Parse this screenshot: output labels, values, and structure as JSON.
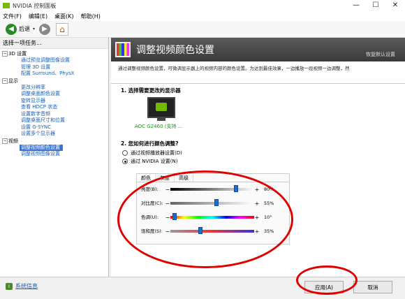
{
  "window": {
    "title": "NVIDIA 控制面板",
    "controls": [
      "—",
      "☐",
      "✕"
    ]
  },
  "menu": [
    "文件(F)",
    "编辑(E)",
    "桌面(K)",
    "帮助(H)"
  ],
  "toolbar": {
    "back_label": "后退",
    "forward_dropdown": "▾"
  },
  "left": {
    "header": "选择一项任务...",
    "tree": [
      {
        "category": "3D 设置",
        "items": [
          "通过预览调整图像设置",
          "管理 3D 设置",
          "配置 Surround、PhysX"
        ]
      },
      {
        "category": "显示",
        "items": [
          "更改分辨率",
          "调整桌面颜色设置",
          "旋转显示器",
          "查看 HDCP 状态",
          "设置数字音频",
          "调整桌面尺寸和位置",
          "设置 G-SYNC",
          "设置多个显示器"
        ]
      },
      {
        "category": "视频",
        "items": [
          "调整视频颜色设置",
          "调整视频图像设置"
        ]
      }
    ],
    "selected": "调整视频颜色设置",
    "system_info": "系统信息"
  },
  "main": {
    "title": "调整视频颜色设置",
    "restore": "恢复默认设置",
    "description": "通过调整视频颜色设置，可微调显示器上的视频内容的颜色设置。为达到最佳效果，一边播放一段视频一边调整，然",
    "section1": "1. 选择需要更改的显示器",
    "monitor_label": "AOC G2460 (支持 ...",
    "section2": "2. 您如何进行颜色调整?",
    "radio1": "通过视频播放器设置(D)",
    "radio2": "通过 NVIDIA 设置(N)",
    "tabs": [
      "颜色",
      "灰度",
      "高级"
    ],
    "sliders": [
      {
        "label": "亮度(B):",
        "value": "80%",
        "pos": 0.8,
        "gradient": "linear-gradient(90deg,#000,#fff)"
      },
      {
        "label": "对比度(C):",
        "value": "55%",
        "pos": 0.55,
        "gradient": "linear-gradient(90deg,#666,#fff)"
      },
      {
        "label": "色调(U):",
        "value": "10°",
        "pos": 0.03,
        "gradient": "linear-gradient(90deg,#f00,#ff0,#0f0,#0ff,#00f,#f0f,#f00)"
      },
      {
        "label": "饱和度(S):",
        "value": "35%",
        "pos": 0.35,
        "gradient": "linear-gradient(90deg,#999,#e33,#33e)"
      }
    ]
  },
  "buttons": {
    "apply": "应用(A)",
    "cancel": "取消"
  }
}
